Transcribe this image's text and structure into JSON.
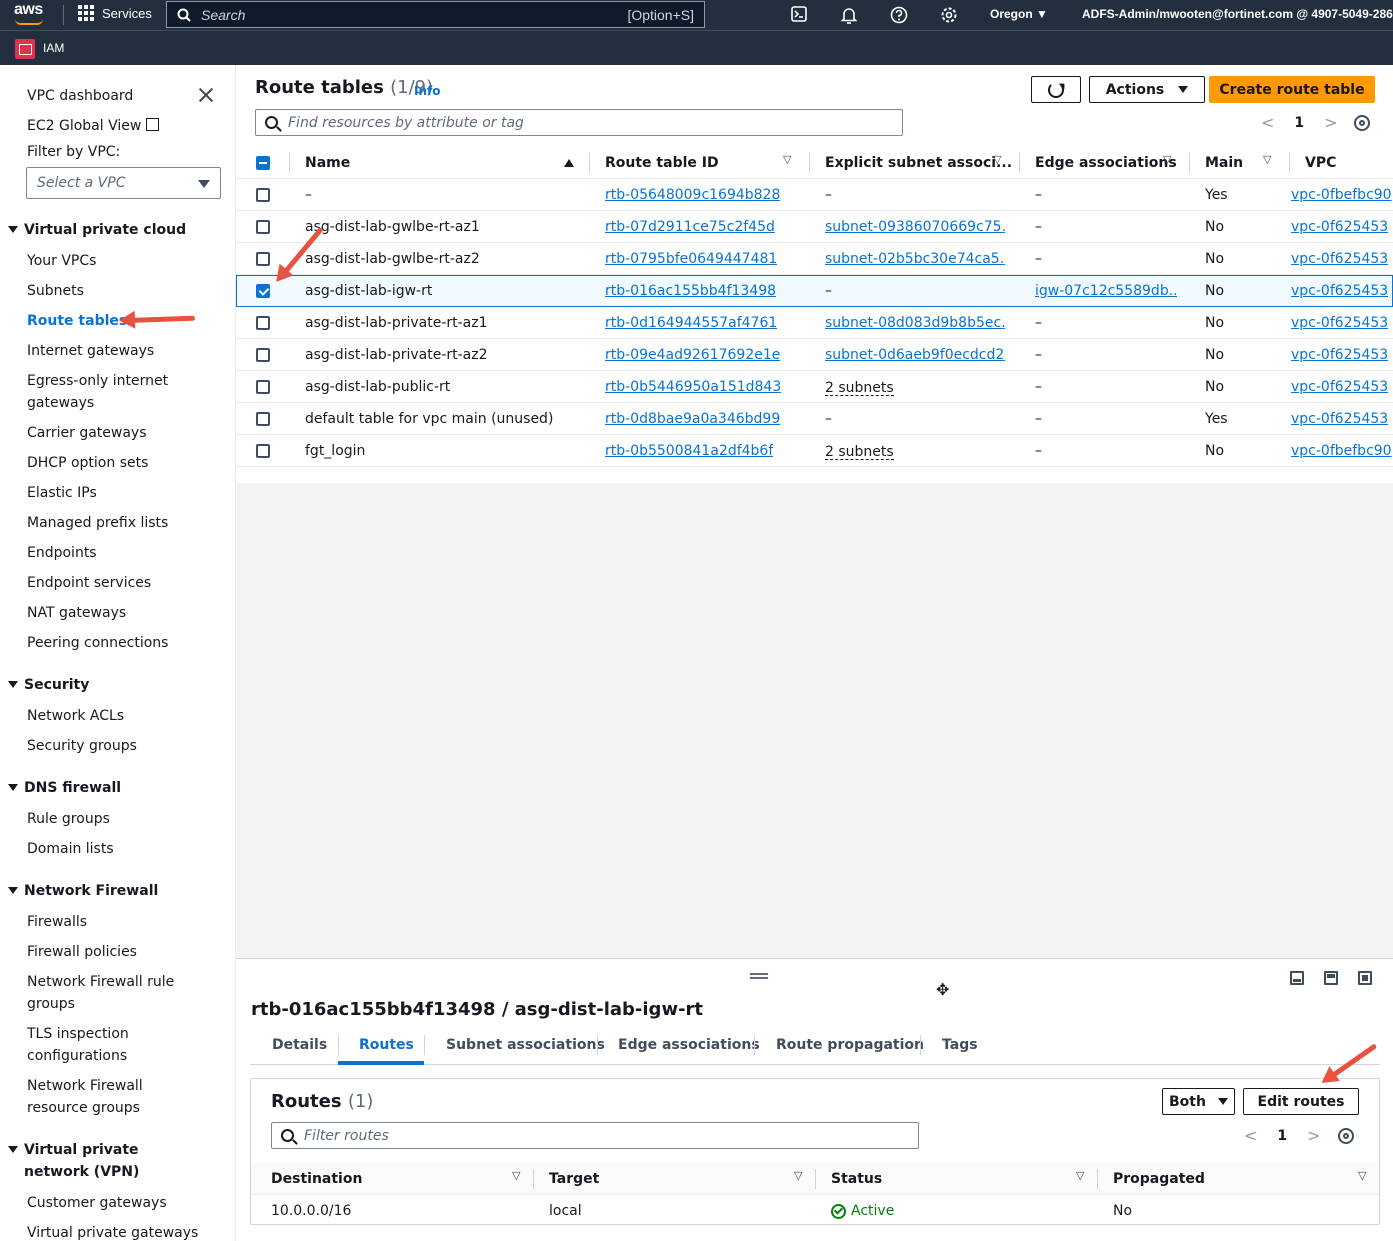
{
  "topnav": {
    "logo": "aws",
    "services": "Services",
    "search_placeholder": "Search",
    "search_shortcut": "[Option+S]",
    "region": "Oregon",
    "account": "ADFS-Admin/mwooten@fortinet.com @ 4907-5049-2865"
  },
  "subnav": {
    "label": "IAM"
  },
  "sidebar": {
    "vpc_dashboard": "VPC dashboard",
    "ec2_global_view": "EC2 Global View",
    "filter_by_vpc": "Filter by VPC:",
    "select_vpc_placeholder": "Select a VPC",
    "sections": {
      "vpc": "Virtual private cloud",
      "security": "Security",
      "dns_firewall": "DNS firewall",
      "network_firewall": "Network Firewall",
      "vpn": "Virtual private network (VPN)"
    },
    "items": {
      "your_vpcs": "Your VPCs",
      "subnets": "Subnets",
      "route_tables": "Route tables",
      "internet_gateways": "Internet gateways",
      "egress_only": "Egress-only internet gateways",
      "carrier_gateways": "Carrier gateways",
      "dhcp_option_sets": "DHCP option sets",
      "elastic_ips": "Elastic IPs",
      "managed_prefix_lists": "Managed prefix lists",
      "endpoints": "Endpoints",
      "endpoint_services": "Endpoint services",
      "nat_gateways": "NAT gateways",
      "peering_connections": "Peering connections",
      "network_acls": "Network ACLs",
      "security_groups": "Security groups",
      "rule_groups": "Rule groups",
      "domain_lists": "Domain lists",
      "firewalls": "Firewalls",
      "firewall_policies": "Firewall policies",
      "nf_rule_groups": "Network Firewall rule groups",
      "tls_inspection": "TLS inspection configurations",
      "nf_resource_groups": "Network Firewall resource groups",
      "customer_gateways": "Customer gateways",
      "virtual_private_gateways": "Virtual private gateways"
    }
  },
  "route_tables": {
    "title": "Route tables",
    "count": "(1/9)",
    "info": "Info",
    "actions": "Actions",
    "create": "Create route table",
    "filter_placeholder": "Find resources by attribute or tag",
    "page": "1",
    "columns": {
      "name": "Name",
      "id": "Route table ID",
      "explicit": "Explicit subnet associ...",
      "edge": "Edge associations",
      "main": "Main",
      "vpc": "VPC"
    },
    "rows": [
      {
        "name": "–",
        "id": "rtb-05648009c1694b828",
        "explicit": "–",
        "edge": "–",
        "main": "Yes",
        "vpc": "vpc-0fbefbc90"
      },
      {
        "name": "asg-dist-lab-gwlbe-rt-az1",
        "id": "rtb-07d2911ce75c2f45d",
        "explicit": "subnet-09386070669c75...",
        "edge": "–",
        "main": "No",
        "vpc": "vpc-0f625453"
      },
      {
        "name": "asg-dist-lab-gwlbe-rt-az2",
        "id": "rtb-0795bfe0649447481",
        "explicit": "subnet-02b5bc30e74ca5...",
        "edge": "–",
        "main": "No",
        "vpc": "vpc-0f625453"
      },
      {
        "name": "asg-dist-lab-igw-rt",
        "id": "rtb-016ac155bb4f13498",
        "explicit": "–",
        "edge": "igw-07c12c5589db...",
        "main": "No",
        "vpc": "vpc-0f625453"
      },
      {
        "name": "asg-dist-lab-private-rt-az1",
        "id": "rtb-0d164944557af4761",
        "explicit": "subnet-08d083d9b8b5ec...",
        "edge": "–",
        "main": "No",
        "vpc": "vpc-0f625453"
      },
      {
        "name": "asg-dist-lab-private-rt-az2",
        "id": "rtb-09e4ad92617692e1e",
        "explicit": "subnet-0d6aeb9f0ecdcd2...",
        "edge": "–",
        "main": "No",
        "vpc": "vpc-0f625453"
      },
      {
        "name": "asg-dist-lab-public-rt",
        "id": "rtb-0b5446950a151d843",
        "explicit": "2 subnets",
        "edge": "–",
        "main": "No",
        "vpc": "vpc-0f625453"
      },
      {
        "name": "default table for vpc main (unused)",
        "id": "rtb-0d8bae9a0a346bd99",
        "explicit": "–",
        "edge": "–",
        "main": "Yes",
        "vpc": "vpc-0f625453"
      },
      {
        "name": "fgt_login",
        "id": "rtb-0b5500841a2df4b6f",
        "explicit": "2 subnets",
        "edge": "–",
        "main": "No",
        "vpc": "vpc-0fbefbc90"
      }
    ]
  },
  "detail": {
    "title": "rtb-016ac155bb4f13498 / asg-dist-lab-igw-rt",
    "tabs": {
      "details": "Details",
      "routes": "Routes",
      "subnet_assoc": "Subnet associations",
      "edge_assoc": "Edge associations",
      "route_prop": "Route propagation",
      "tags": "Tags"
    },
    "routes": {
      "title": "Routes",
      "count": "(1)",
      "both": "Both",
      "edit": "Edit routes",
      "filter_placeholder": "Filter routes",
      "page": "1",
      "columns": {
        "destination": "Destination",
        "target": "Target",
        "status": "Status",
        "propagated": "Propagated"
      },
      "rows": [
        {
          "destination": "10.0.0.0/16",
          "target": "local",
          "status": "Active",
          "propagated": "No"
        }
      ]
    }
  },
  "colors": {
    "nav_bg": "#232f3e",
    "link": "#0972d3",
    "primary_button": "#ff9900",
    "success": "#037f0c",
    "annotation_arrow": "#e8533f"
  }
}
